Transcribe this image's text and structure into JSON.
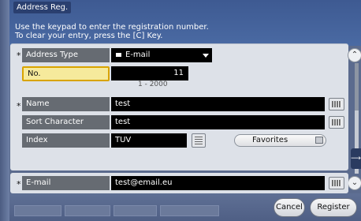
{
  "header": {
    "title": "Address Reg.",
    "instruction_line1": "Use the keypad to enter the registration number.",
    "instruction_line2": "To clear your entry, press the [C] Key."
  },
  "form": {
    "address_type": {
      "label": "Address Type",
      "value": "E-mail",
      "required": "*"
    },
    "number": {
      "label": "No.",
      "value": "11",
      "range": "1 - 2000"
    },
    "name": {
      "label": "Name",
      "value": "test",
      "required": "*"
    },
    "sort_character": {
      "label": "Sort Character",
      "value": "test"
    },
    "index": {
      "label": "Index",
      "value": "TUV"
    },
    "favorites": {
      "label": "Favorites"
    },
    "email": {
      "label": "E-mail",
      "value": "test@email.eu",
      "required": "*"
    }
  },
  "footer": {
    "cancel_label": "Cancel",
    "register_label": "Register"
  },
  "colors": {
    "header_blue": "#3e5a92",
    "field_black": "#000000",
    "label_gray": "#666b72",
    "highlight_yellow": "#f6ea9c"
  }
}
